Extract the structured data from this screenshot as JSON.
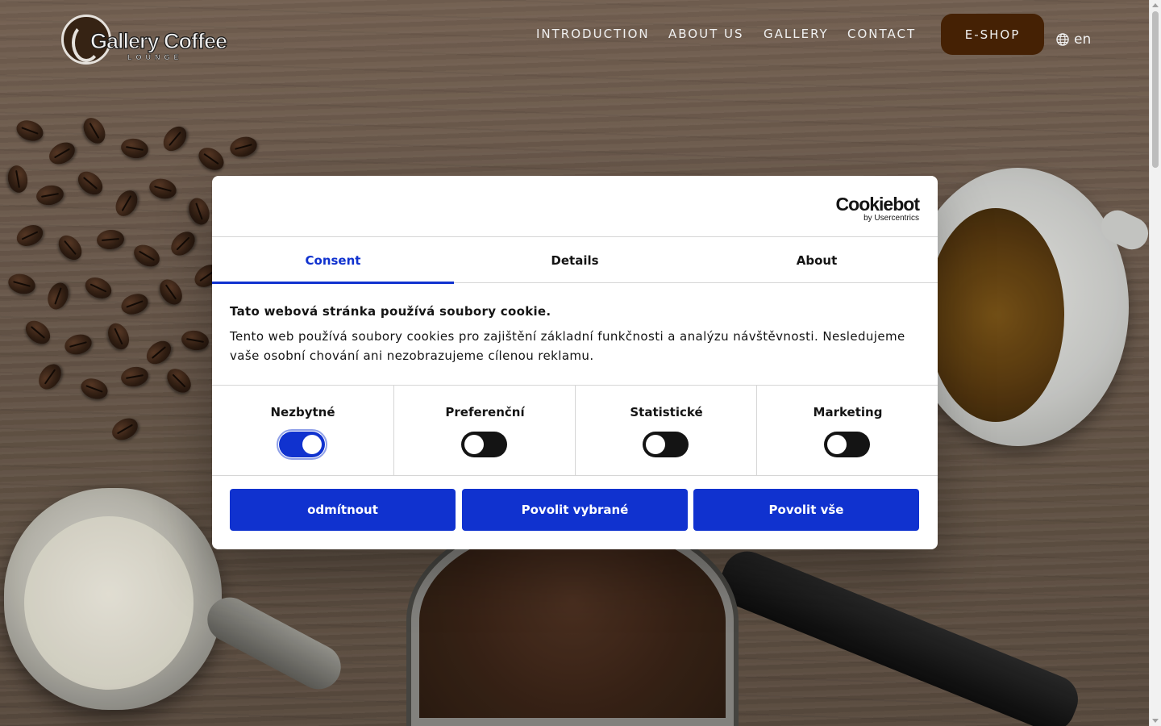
{
  "header": {
    "logo_text": "Gallery Coffee",
    "logo_subtext": "LOUNGE",
    "nav": [
      "INTRODUCTION",
      "ABOUT US",
      "GALLERY",
      "CONTACT"
    ],
    "eshop_label": "E-SHOP",
    "language": "en"
  },
  "cookie_dialog": {
    "brand": "Cookiebot",
    "brand_sub": "by Usercentrics",
    "tabs": [
      "Consent",
      "Details",
      "About"
    ],
    "active_tab": "Consent",
    "title": "Tato webová stránka používá soubory cookie.",
    "text": "Tento web používá soubory cookies pro zajištění základní funkčnosti a analýzu návštěvnosti. Nesledujeme vaše osobní chování ani nezobrazujeme cílenou reklamu.",
    "categories": [
      {
        "label": "Nezbytné",
        "enabled": true
      },
      {
        "label": "Preferenční",
        "enabled": false
      },
      {
        "label": "Statistické",
        "enabled": false
      },
      {
        "label": "Marketing",
        "enabled": false
      }
    ],
    "buttons": {
      "deny": "odmítnout",
      "allow_selected": "Povolit vybrané",
      "allow_all": "Povolit vše"
    }
  },
  "colors": {
    "accent_blue": "#1032cf",
    "eshop_brown": "#4a2405"
  }
}
